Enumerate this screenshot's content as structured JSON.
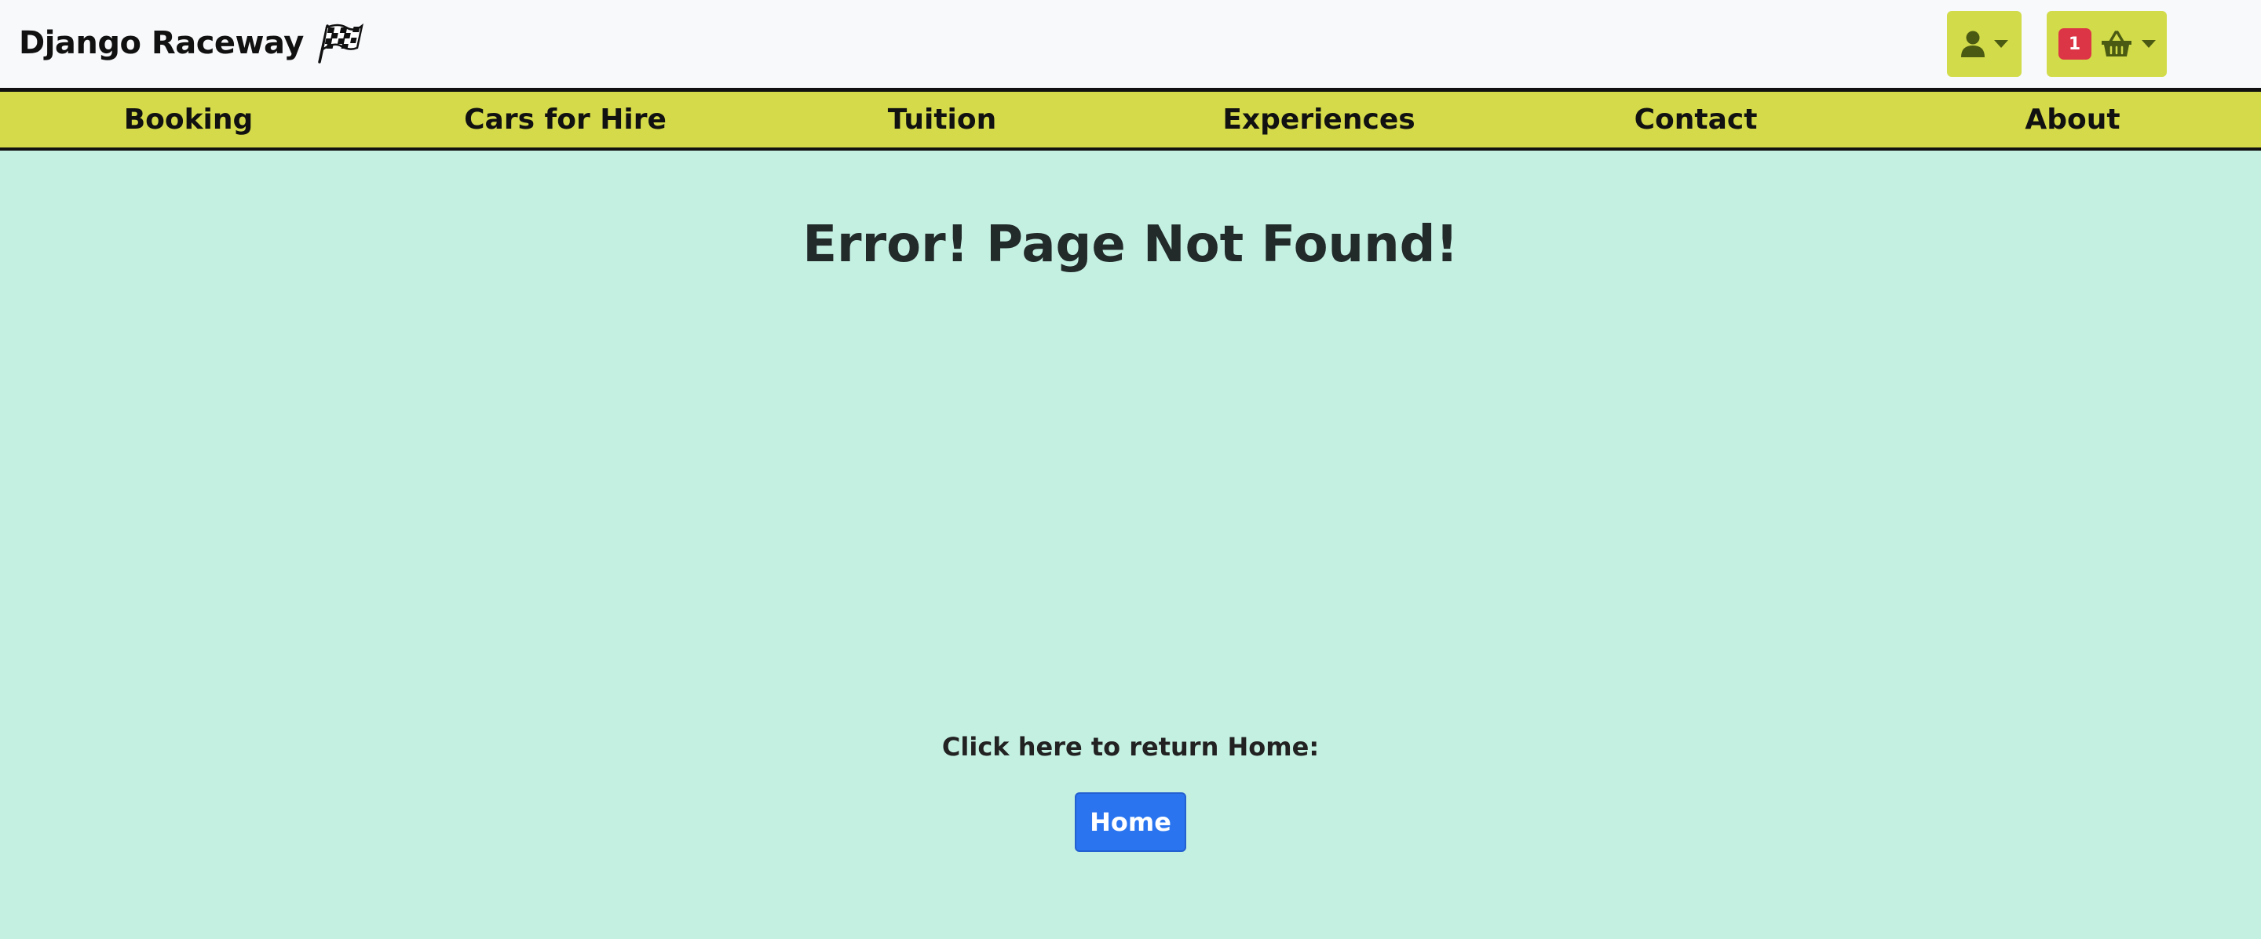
{
  "brand": {
    "name": "Django Raceway",
    "icon": "checkered-flag-icon"
  },
  "header": {
    "account_icon": "user-icon",
    "basket_icon": "basket-icon",
    "basket_count": "1"
  },
  "nav": {
    "items": [
      {
        "label": "Booking"
      },
      {
        "label": "Cars for Hire"
      },
      {
        "label": "Tuition"
      },
      {
        "label": "Experiences"
      },
      {
        "label": "Contact"
      },
      {
        "label": "About"
      }
    ]
  },
  "main": {
    "title": "Error! Page Not Found!",
    "return_text": "Click here to return Home:",
    "home_button": "Home"
  },
  "colors": {
    "page_background": "#c4f0e2",
    "nav_background": "#d4da49",
    "badge": "#dc3545",
    "home_button": "#2a75ef"
  }
}
